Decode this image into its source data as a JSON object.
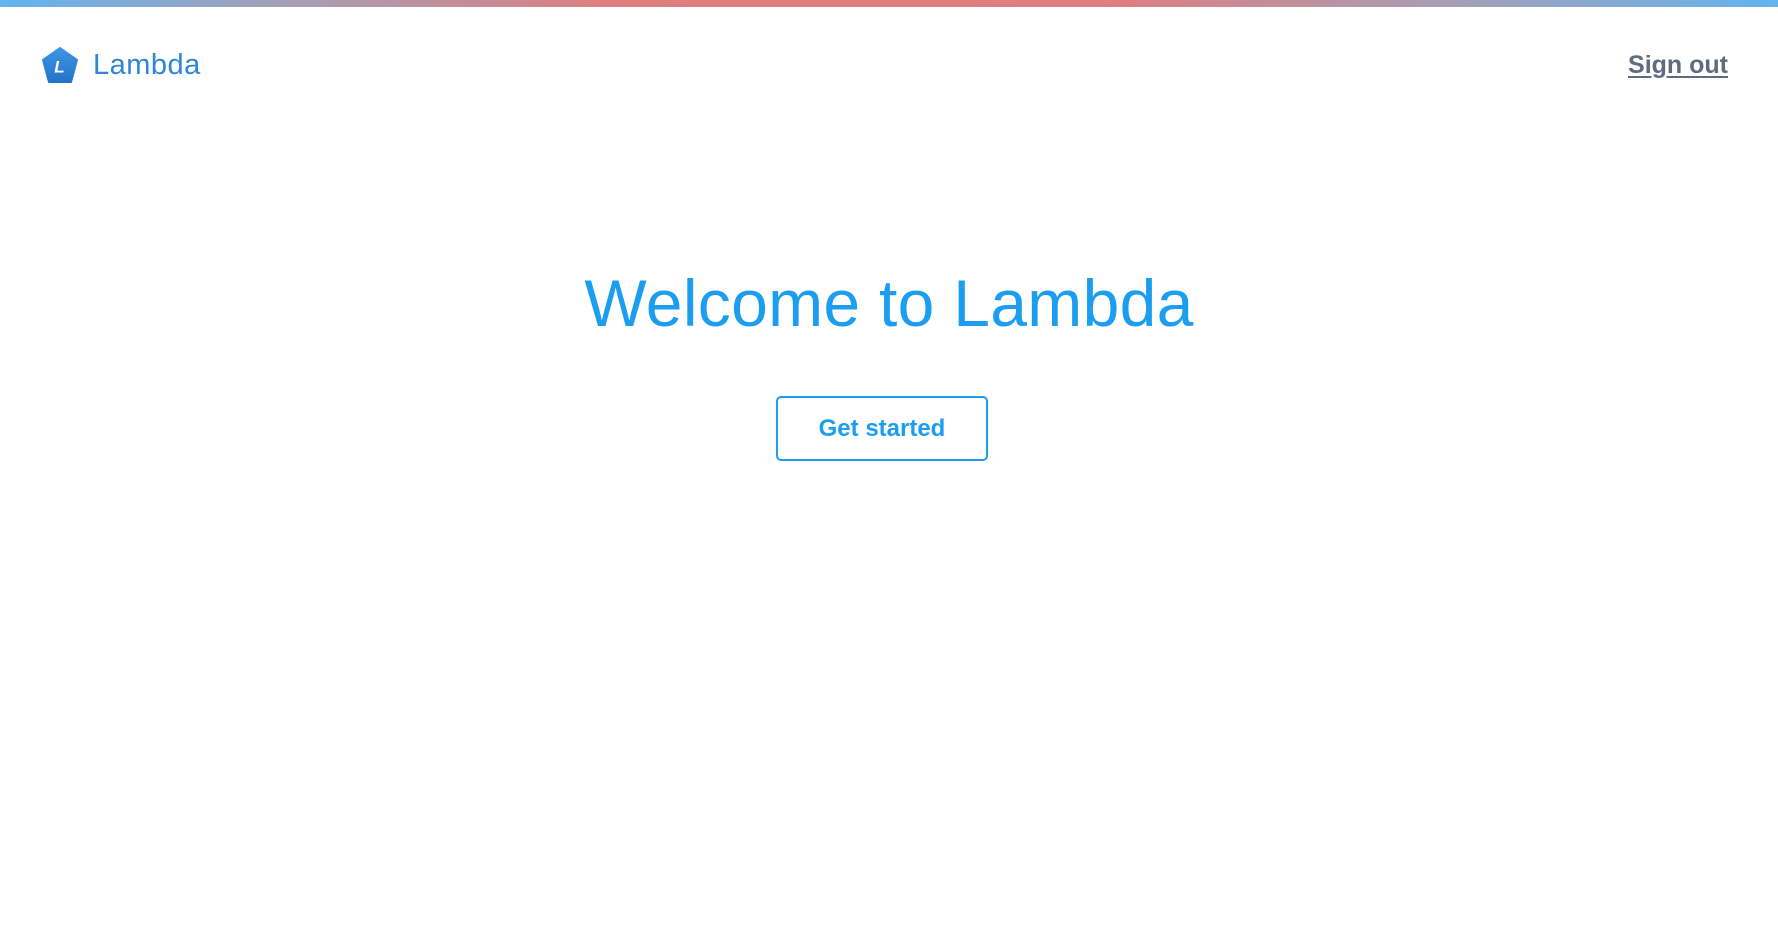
{
  "header": {
    "brand_name": "Lambda",
    "logo_letter": "L",
    "sign_out_label": "Sign out"
  },
  "main": {
    "title": "Welcome to Lambda",
    "cta_label": "Get started"
  },
  "colors": {
    "brand": "#2e86d8",
    "accent": "#1c9ef0",
    "signout_text": "#5f6b7e",
    "top_bar_gradient": [
      "#62b4ef",
      "#dd7f7f",
      "#62b4ef"
    ]
  },
  "icons": {
    "logo": "lambda-pentagon-logo-icon"
  }
}
